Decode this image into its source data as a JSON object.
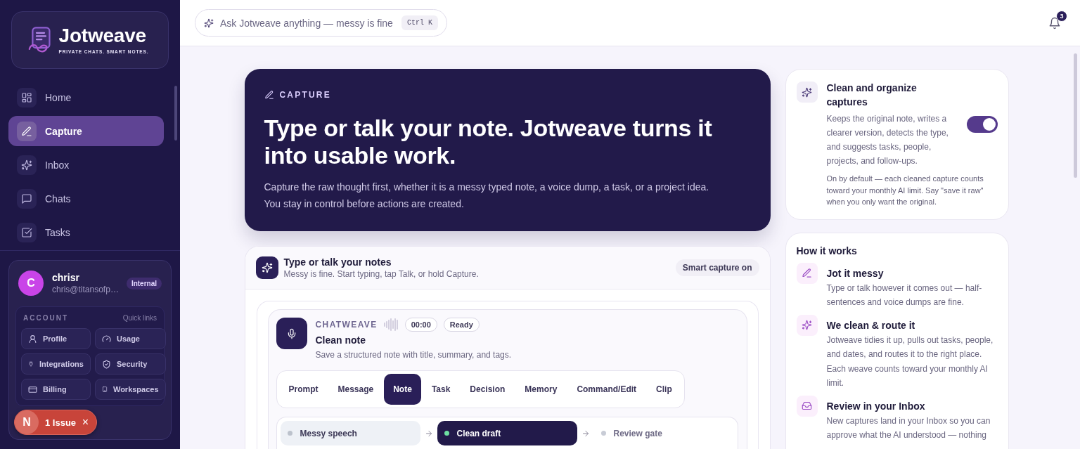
{
  "sidebar": {
    "logo": {
      "name": "Jotweave",
      "tagline": "PRIVATE CHATS. SMART NOTES."
    },
    "nav": [
      {
        "label": "Home",
        "selected": false
      },
      {
        "label": "Capture",
        "selected": true
      },
      {
        "label": "Inbox",
        "selected": false
      },
      {
        "label": "Chats",
        "selected": false
      },
      {
        "label": "Tasks",
        "selected": false
      }
    ],
    "user": {
      "avatar_letter": "C",
      "name": "chrisr",
      "email": "chris@titansofp…",
      "badge": "Internal"
    },
    "account": {
      "heading": "ACCOUNT",
      "caption": "Quick links",
      "links": [
        "Profile",
        "Usage",
        "Integrations",
        "Security",
        "Billing",
        "Workspaces"
      ]
    }
  },
  "dev_indicator": {
    "logo": "N",
    "label": "1 Issue",
    "close": "×"
  },
  "topbar": {
    "ask": {
      "label": "Ask Jotweave anything — messy is fine",
      "shortcut": "Ctrl K"
    },
    "notifications": {
      "count": "3"
    }
  },
  "hero": {
    "eyebrow": "CAPTURE",
    "title": "Type or talk your note. Jotweave turns it into usable work.",
    "body": [
      "Capture the raw thought first, whether it is a messy typed note, a voice dump, a task, or a project idea.",
      "You stay in control before actions are created."
    ]
  },
  "capture": {
    "title": "Type or talk your notes",
    "subtitle": "Messy is fine. Start typing, tap Talk, or hold Capture.",
    "badge": "Smart capture on",
    "composer": {
      "brand": "CHATWEAVE",
      "timer": "00:00",
      "status": "Ready",
      "title": "Clean note",
      "description": "Save a structured note with title, summary, and tags.",
      "modes": [
        {
          "label": "Prompt",
          "selected": false
        },
        {
          "label": "Message",
          "selected": false
        },
        {
          "label": "Note",
          "selected": true
        },
        {
          "label": "Task",
          "selected": false
        },
        {
          "label": "Decision",
          "selected": false
        },
        {
          "label": "Memory",
          "selected": false
        },
        {
          "label": "Command/Edit",
          "selected": false
        },
        {
          "label": "Clip",
          "selected": false
        }
      ],
      "steps": [
        {
          "label": "Messy speech",
          "done": true,
          "selected": false
        },
        {
          "label": "Clean draft",
          "done": false,
          "selected": true
        },
        {
          "label": "Review gate",
          "done": false,
          "selected": false
        }
      ]
    }
  },
  "settings_card": {
    "title": "Clean and organize captures",
    "description": "Keeps the original note, writes a clearer version, detects the type, and suggests tasks, people, projects, and follow-ups.",
    "enabled": true,
    "note": "On by default — each cleaned capture counts toward your monthly AI limit. Say \"save it raw\" when you only want the original."
  },
  "how_it_works": {
    "title": "How it works",
    "steps": [
      {
        "title": "Jot it messy",
        "description": "Type or talk however it comes out — half-sentences and voice dumps are fine."
      },
      {
        "title": "We clean & route it",
        "description": "Jotweave tidies it up, pulls out tasks, people, and dates, and routes it to the right place. Each weave counts toward your monthly AI limit."
      },
      {
        "title": "Review in your Inbox",
        "description": "New captures land in your Inbox so you can approve what the AI understood — nothing"
      }
    ]
  }
}
